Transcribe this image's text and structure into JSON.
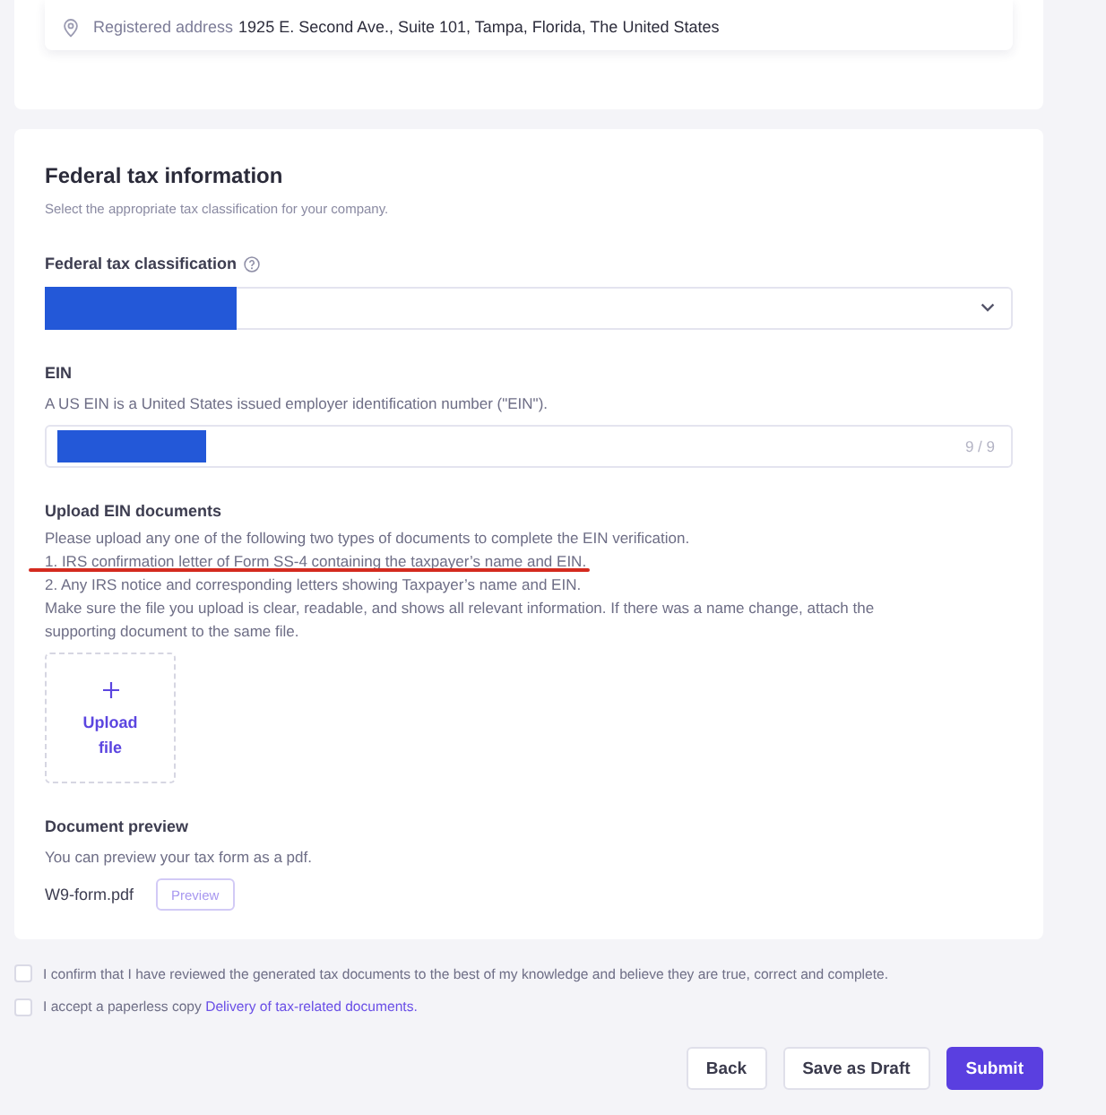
{
  "address": {
    "label": "Registered address",
    "value": "1925 E. Second Ave., Suite 101, Tampa, Florida, The United States"
  },
  "federal_tax": {
    "title": "Federal tax information",
    "subtitle": "Select the appropriate tax classification for your company.",
    "classification": {
      "label": "Federal tax classification",
      "redacted": true
    },
    "ein": {
      "label": "EIN",
      "description": "A US EIN is a United States issued employer identification number (\"EIN\").",
      "redacted": true,
      "counter": "9 / 9"
    },
    "upload": {
      "label": "Upload EIN documents",
      "lines": [
        {
          "text": "Please upload any one of the following two types of documents to complete the EIN verification.",
          "underlined": false
        },
        {
          "text": "1. IRS confirmation letter of Form SS-4 containing the taxpayer’s name and EIN.",
          "underlined": true
        },
        {
          "text": "2. Any IRS notice and corresponding letters showing Taxpayer’s name and EIN.",
          "underlined": false
        },
        {
          "text": "Make sure the file you upload is clear, readable, and shows all relevant information. If there was a name change, attach the supporting document to the same file.",
          "underlined": false
        }
      ],
      "button": "Upload file"
    },
    "preview": {
      "label": "Document preview",
      "description": "You can preview your tax form as a pdf.",
      "file_name": "W9-form.pdf",
      "button": "Preview"
    }
  },
  "agreements": [
    {
      "text": "I confirm that I have reviewed the generated tax documents to the best of my knowledge and believe they are true, correct and complete.",
      "checked": false
    },
    {
      "text": "I accept a paperless copy ",
      "link": "Delivery of tax-related documents.",
      "checked": false
    }
  ],
  "buttons": [
    {
      "label": "Back",
      "kind": "secondary"
    },
    {
      "label": "Save as Draft",
      "kind": "secondary"
    },
    {
      "label": "Submit",
      "kind": "primary"
    }
  ]
}
